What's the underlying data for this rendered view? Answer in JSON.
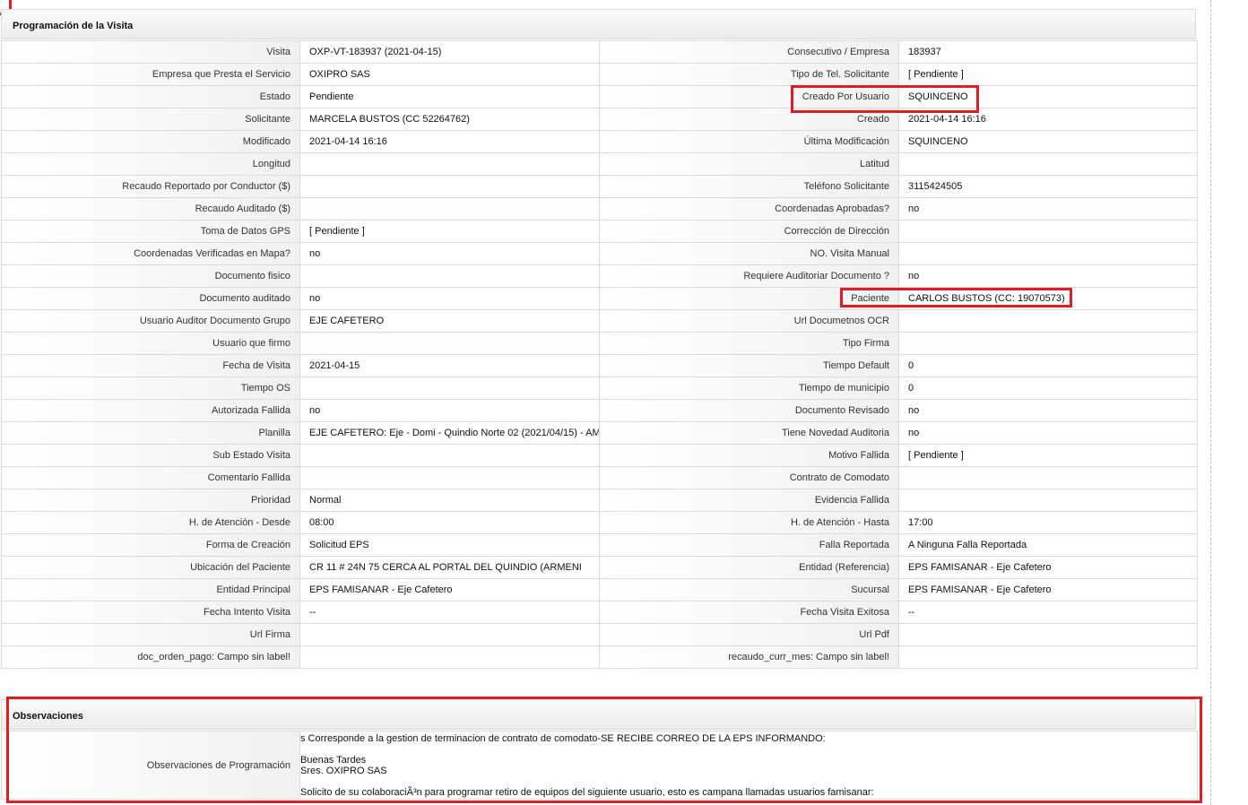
{
  "section1_title": "Programación de la Visita",
  "section2_title": "Observaciones",
  "rows": [
    {
      "l1": "Visita",
      "v1": "OXP-VT-183937 (2021-04-15)",
      "l2": "Consecutivo / Empresa",
      "v2": "183937"
    },
    {
      "l1": "Empresa que Presta el Servicio",
      "v1": "OXIPRO SAS",
      "l2": "Tipo de Tel. Solicitante",
      "v2": "[ Pendiente ]"
    },
    {
      "l1": "Estado",
      "v1": "Pendiente",
      "l2": "Creado Por Usuario",
      "v2": "SQUINCENO"
    },
    {
      "l1": "Solicitante",
      "v1": "MARCELA BUSTOS (CC 52264762)",
      "l2": "Creado",
      "v2": "2021-04-14 16:16"
    },
    {
      "l1": "Modificado",
      "v1": "2021-04-14 16:16",
      "l2": "Última Modificación",
      "v2": " SQUINCENO"
    },
    {
      "l1": "Longitud",
      "v1": "",
      "l2": "Latitud",
      "v2": ""
    },
    {
      "l1": "Recaudo Reportado por Conductor ($)",
      "v1": "",
      "l2": "Teléfono Solicitante",
      "v2": "3115424505"
    },
    {
      "l1": "Recaudo Auditado ($)",
      "v1": "",
      "l2": "Coordenadas Aprobadas?",
      "v2": " no"
    },
    {
      "l1": "Toma de Datos GPS",
      "v1": "[ Pendiente ]",
      "l2": "Corrección de Dirección",
      "v2": ""
    },
    {
      "l1": "Coordenadas Verificadas en Mapa?",
      "v1": " no",
      "l2": "NO. Visita Manual",
      "v2": ""
    },
    {
      "l1": "Documento fisico",
      "v1": "",
      "l2": "Requiere Auditoriar Documento ?",
      "v2": " no"
    },
    {
      "l1": "Documento auditado",
      "v1": " no",
      "l2": "Paciente",
      "v2": "CARLOS BUSTOS (CC: 19070573)"
    },
    {
      "l1": "Usuario Auditor Documento Grupo",
      "v1": "EJE CAFETERO",
      "l2": "Url Documetnos OCR",
      "v2": ""
    },
    {
      "l1": "Usuario que firmo",
      "v1": "",
      "l2": "Tipo Firma",
      "v2": ""
    },
    {
      "l1": "Fecha de Visita",
      "v1": " 2021-04-15",
      "l2": "Tiempo Default",
      "v2": "0"
    },
    {
      "l1": "Tiempo OS",
      "v1": "",
      "l2": "Tiempo de municipio",
      "v2": "0"
    },
    {
      "l1": "Autorizada Fallida",
      "v1": "no",
      "l2": "Documento Revisado",
      "v2": " no"
    },
    {
      "l1": "Planilla",
      "v1": "EJE CAFETERO: Eje - Domi - Quindio Norte 02 (2021/04/15) - AM",
      "l2": "Tiene Novedad Auditoria",
      "v2": " no"
    },
    {
      "l1": "Sub Estado Visita",
      "v1": "",
      "l2": "Motivo Fallida",
      "v2": "[ Pendiente ]"
    },
    {
      "l1": "Comentario Fallida",
      "v1": "",
      "l2": "Contrato de Comodato",
      "v2": ""
    },
    {
      "l1": "Prioridad",
      "v1": "Normal",
      "l2": "Evidencia Fallida",
      "v2": ""
    },
    {
      "l1": "H. de Atención - Desde",
      "v1": "08:00",
      "l2": "H. de Atención - Hasta",
      "v2": "17:00"
    },
    {
      "l1": "Forma de Creación",
      "v1": "Solicitud EPS",
      "l2": "Falla Reportada",
      "v2": "A Ninguna Falla Reportada"
    },
    {
      "l1": "Ubicación del Paciente",
      "v1": "CR 11 # 24N 75 CERCA AL PORTAL DEL QUINDIO (ARMENI",
      "l2": "Entidad (Referencia)",
      "v2": "EPS FAMISANAR - Eje Cafetero"
    },
    {
      "l1": "Entidad Principal",
      "v1": "EPS FAMISANAR - Eje Cafetero",
      "l2": "Sucursal",
      "v2": "EPS FAMISANAR - Eje Cafetero"
    },
    {
      "l1": "Fecha Intento Visita",
      "v1": " --",
      "l2": "Fecha Visita Exitosa",
      "v2": " --"
    },
    {
      "l1": "Url Firma",
      "v1": "",
      "l2": "Url Pdf",
      "v2": ""
    },
    {
      "l1": "doc_orden_pago: Campo sin label!",
      "v1": "",
      "l2": "recaudo_curr_mes: Campo sin label!",
      "v2": ""
    }
  ],
  "obs_label": "Observaciones de Programación",
  "obs_text": "s Corresponde a la gestion de terminacion de contrato de comodato-SE RECIBE CORREO DE LA EPS INFORMANDO:\n\nBuenas Tardes\nSres. OXIPRO SAS\n\nSolicito de su colaboraciÃ³n para programar retiro de equipos del siguiente usuario, esto es campana llamadas usuarios famisanar:",
  "colors": {
    "highlight": "#e31b23",
    "border": "#dcdcdc"
  }
}
